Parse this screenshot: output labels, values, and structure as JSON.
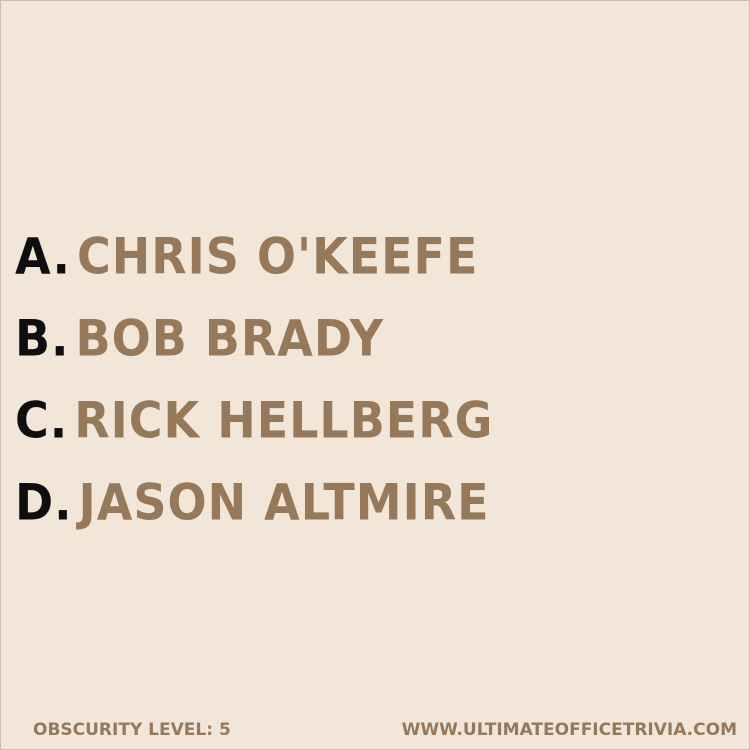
{
  "options": [
    {
      "letter": "A.",
      "answer": "CHRIS O'KEEFE"
    },
    {
      "letter": "B.",
      "answer": "BOB BRADY"
    },
    {
      "letter": "C.",
      "answer": "RICK HELLBERG"
    },
    {
      "letter": "D.",
      "answer": "JASON ALTMIRE"
    }
  ],
  "footer": {
    "obscurity": "OBSCURITY LEVEL: 5",
    "website": "WWW.ULTIMATEOFFICETRIVIA.COM"
  },
  "colors": {
    "background": "#f2e6d8",
    "letter": "#0e0e0e",
    "answer": "#95795a"
  }
}
